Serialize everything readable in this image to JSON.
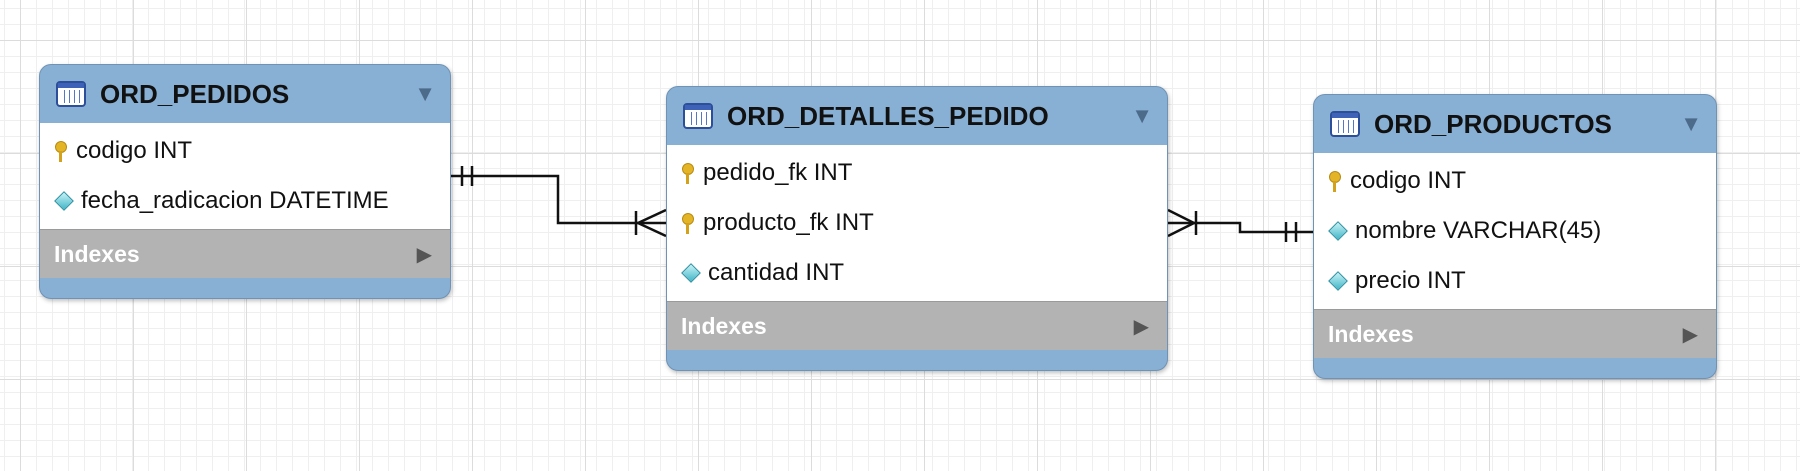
{
  "tables": [
    {
      "name": "ORD_PEDIDOS",
      "columns": [
        {
          "kind": "key",
          "text": "codigo INT"
        },
        {
          "kind": "column",
          "text": "fecha_radicacion DATETIME"
        }
      ],
      "indexes_label": "Indexes"
    },
    {
      "name": "ORD_DETALLES_PEDIDO",
      "columns": [
        {
          "kind": "key",
          "text": "pedido_fk INT"
        },
        {
          "kind": "key",
          "text": "producto_fk INT"
        },
        {
          "kind": "column",
          "text": "cantidad INT"
        }
      ],
      "indexes_label": "Indexes"
    },
    {
      "name": "ORD_PRODUCTOS",
      "columns": [
        {
          "kind": "key",
          "text": "codigo INT"
        },
        {
          "kind": "column",
          "text": "nombre VARCHAR(45)"
        },
        {
          "kind": "column",
          "text": "precio INT"
        }
      ],
      "indexes_label": "Indexes"
    }
  ],
  "relationships": [
    {
      "from": "ORD_PEDIDOS",
      "to": "ORD_DETALLES_PEDIDO",
      "from_cardinality": "one",
      "to_cardinality": "many"
    },
    {
      "from": "ORD_PRODUCTOS",
      "to": "ORD_DETALLES_PEDIDO",
      "from_cardinality": "one",
      "to_cardinality": "many"
    }
  ],
  "icons": {
    "table": "table-icon",
    "primary_key": "key-icon",
    "column": "diamond-icon",
    "collapse": "triangle-down-icon",
    "expand": "triangle-right-icon"
  },
  "colors": {
    "header": "#88b0d4",
    "indexes_bar": "#b3b3b3",
    "key": "#e3b526",
    "column_diamond": "#43b6c8"
  },
  "glyphs": {
    "collapse": "▼",
    "expand": "▶"
  }
}
